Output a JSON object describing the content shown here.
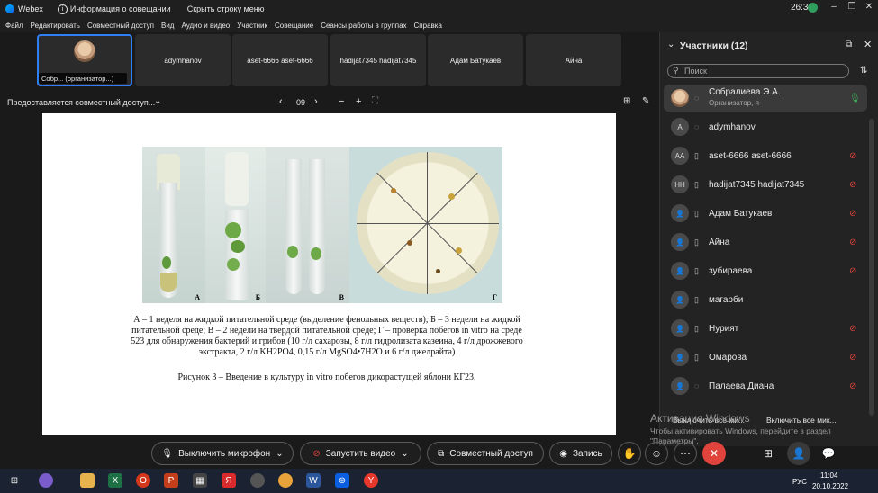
{
  "titlebar": {
    "app": "Webex",
    "info": "Информация о совещании",
    "hide_menu": "Скрыть строку меню",
    "time": "26:36"
  },
  "menu": [
    "Файл",
    "Редактировать",
    "Совместный доступ",
    "Вид",
    "Аудио и видео",
    "Участник",
    "Совещание",
    "Сеансы работы в группах",
    "Справка"
  ],
  "tiles": [
    {
      "label": "Собр... (организатор...)"
    },
    {
      "label": "adymhanov"
    },
    {
      "label": "aset-6666 aset-6666"
    },
    {
      "label": "hadijat7345 hadijat7345"
    },
    {
      "label": "Адам Батукаев"
    },
    {
      "label": "Айна"
    }
  ],
  "share": {
    "label": "Предоставляется совместный доступ...",
    "page": "09"
  },
  "slide": {
    "panel_labels": [
      "А",
      "Б",
      "В",
      "Г"
    ],
    "caption": "А – 1 неделя на жидкой питательной среде (выделение фенольных веществ); Б – 3 недели на жидкой питательной среде; В – 2 недели на твердой питательной среде; Г – проверка побегов in vitro на среде 523 для обнаружения бактерий и грибов (10 г/л сахарозы, 8 г/л гидролизата казеина, 4 г/л дрожжевого экстракта, 2 г/л KH2PO4, 0,15 г/л MgSO4•7H2O и 6 г/л джелрайта)",
    "figure": "Рисунок 3 – Введение в культуру in vitro побегов дикорастущей яблони КГ23."
  },
  "participants": {
    "title": "Участники (12)",
    "search_placeholder": "Поиск",
    "list": [
      {
        "initials": "",
        "name": "Собралиева Э.А.",
        "role": "Организатор, я",
        "muted": false
      },
      {
        "initials": "A",
        "name": "adymhanov",
        "role": "",
        "muted": false
      },
      {
        "initials": "AA",
        "name": "aset-6666 aset-6666",
        "role": "",
        "muted": true
      },
      {
        "initials": "HH",
        "name": "hadijat7345 hadijat7345",
        "role": "",
        "muted": true
      },
      {
        "initials": "",
        "name": "Адам Батукаев",
        "role": "",
        "muted": true
      },
      {
        "initials": "",
        "name": "Айна",
        "role": "",
        "muted": true
      },
      {
        "initials": "",
        "name": "зубираева",
        "role": "",
        "muted": true
      },
      {
        "initials": "",
        "name": "магарби",
        "role": "",
        "muted": false
      },
      {
        "initials": "",
        "name": "Нурият",
        "role": "",
        "muted": true
      },
      {
        "initials": "",
        "name": "Омарова",
        "role": "",
        "muted": true
      },
      {
        "initials": "",
        "name": "Палаева Диана",
        "role": "",
        "muted": true
      }
    ],
    "mute_all": "Выключить все ми...",
    "unmute_all": "Включить все мик..."
  },
  "controls": {
    "mic": "Выключить микрофон",
    "video": "Запустить видео",
    "share": "Совместный доступ",
    "record": "Запись"
  },
  "watermark": {
    "line1": "Активация Windows",
    "line2": "Чтобы активировать Windows, перейдите в раздел \"Параметры\"."
  },
  "taskbar": {
    "lang": "РУС",
    "time": "11:04",
    "date": "20.10.2022"
  }
}
